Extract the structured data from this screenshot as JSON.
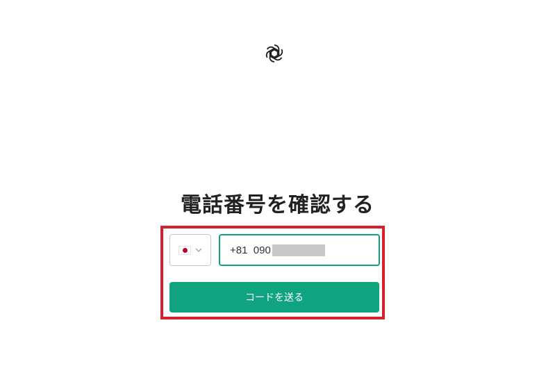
{
  "brand": {
    "logo_icon": "openai-logo-icon"
  },
  "page": {
    "title": "電話番号を確認する"
  },
  "form": {
    "country": {
      "flag_icon": "japan-flag-icon",
      "chevron_icon": "chevron-down-icon"
    },
    "phone": {
      "prefix": "+81",
      "number": "090"
    },
    "submit_label": "コードを送る"
  },
  "colors": {
    "accent": "#10a37f",
    "highlight": "#d6202c",
    "text": "#202123"
  }
}
